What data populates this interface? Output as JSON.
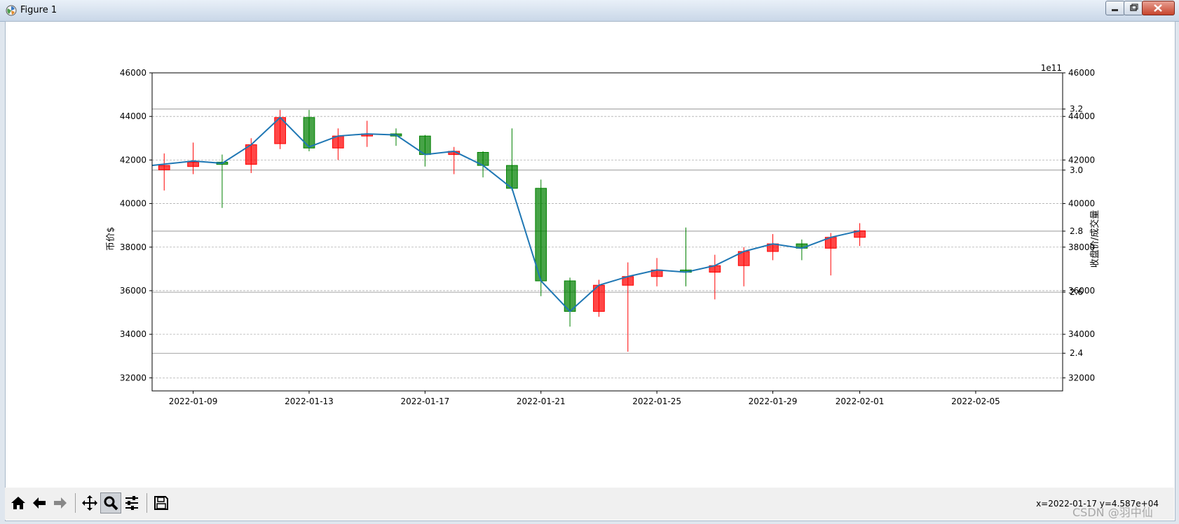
{
  "window": {
    "title": "Figure 1"
  },
  "toolbar": {
    "buttons": [
      {
        "name": "home-button",
        "icon": "home-icon"
      },
      {
        "name": "back-button",
        "icon": "back-arrow-icon"
      },
      {
        "name": "forward-button",
        "icon": "forward-arrow-icon"
      },
      {
        "name": "pan-button",
        "icon": "pan-icon"
      },
      {
        "name": "zoom-button",
        "icon": "zoom-icon"
      },
      {
        "name": "configure-subplots-button",
        "icon": "sliders-icon"
      },
      {
        "name": "save-button",
        "icon": "save-icon"
      }
    ],
    "coords": "x=2022-01-17 y=4.587e+04"
  },
  "watermark": "CSDN @羽中仙",
  "chart_data": {
    "type": "candlestick",
    "ylabel": "币价$",
    "ylabel_right": "收盘价/成交量",
    "offset_text_right": "1e11",
    "ylim": [
      31400,
      46000
    ],
    "xlim": [
      "2022-01-07T14:00",
      "2022-02-08"
    ],
    "x_ticks": [
      "2022-01-09",
      "2022-01-13",
      "2022-01-17",
      "2022-01-21",
      "2022-01-25",
      "2022-01-29",
      "2022-02-01",
      "2022-02-05"
    ],
    "y_ticks": [
      32000,
      34000,
      36000,
      38000,
      40000,
      42000,
      44000,
      46000
    ],
    "right_ticks": [
      32000,
      34000,
      36000,
      38000,
      40000,
      42000,
      44000,
      46000
    ],
    "volume_ticks": [
      "2.4",
      "2.6",
      "2.8",
      "3.0",
      "3.2"
    ],
    "volume_tick_values": [
      2.4,
      2.6,
      2.8,
      3.0,
      3.2
    ],
    "volume_ylim": [
      2.2766,
      3.3186
    ],
    "grid": true,
    "colors": {
      "up": "#ff0000",
      "down": "#008000",
      "line": "#1f77b4",
      "grid": "#b0b0b0"
    },
    "candles": [
      {
        "date": "2022-01-08",
        "open": 41550,
        "close": 41750,
        "high": 42300,
        "low": 40600
      },
      {
        "date": "2022-01-09",
        "open": 41700,
        "close": 41900,
        "high": 42800,
        "low": 41350
      },
      {
        "date": "2022-01-10",
        "open": 41900,
        "close": 41800,
        "high": 42250,
        "low": 39800
      },
      {
        "date": "2022-01-11",
        "open": 41800,
        "close": 42700,
        "high": 43000,
        "low": 41400
      },
      {
        "date": "2022-01-12",
        "open": 42750,
        "close": 43950,
        "high": 44300,
        "low": 42500
      },
      {
        "date": "2022-01-13",
        "open": 43950,
        "close": 42550,
        "high": 44300,
        "low": 42400
      },
      {
        "date": "2022-01-14",
        "open": 42550,
        "close": 43100,
        "high": 43450,
        "low": 42000
      },
      {
        "date": "2022-01-15",
        "open": 43100,
        "close": 43200,
        "high": 43800,
        "low": 42600
      },
      {
        "date": "2022-01-16",
        "open": 43200,
        "close": 43100,
        "high": 43450,
        "low": 42650
      },
      {
        "date": "2022-01-17",
        "open": 43100,
        "close": 42250,
        "high": 43150,
        "low": 41700
      },
      {
        "date": "2022-01-18",
        "open": 42250,
        "close": 42400,
        "high": 42600,
        "low": 41350
      },
      {
        "date": "2022-01-19",
        "open": 42350,
        "close": 41750,
        "high": 42400,
        "low": 41200
      },
      {
        "date": "2022-01-20",
        "open": 41750,
        "close": 40700,
        "high": 43450,
        "low": 40600
      },
      {
        "date": "2022-01-21",
        "open": 40700,
        "close": 36450,
        "high": 41100,
        "low": 35750
      },
      {
        "date": "2022-01-22",
        "open": 36450,
        "close": 35050,
        "high": 36600,
        "low": 34350
      },
      {
        "date": "2022-01-23",
        "open": 35050,
        "close": 36250,
        "high": 36500,
        "low": 34800
      },
      {
        "date": "2022-01-24",
        "open": 36250,
        "close": 36650,
        "high": 37300,
        "low": 33200
      },
      {
        "date": "2022-01-25",
        "open": 36650,
        "close": 36950,
        "high": 37500,
        "low": 36200
      },
      {
        "date": "2022-01-26",
        "open": 36950,
        "close": 36850,
        "high": 38900,
        "low": 36200
      },
      {
        "date": "2022-01-27",
        "open": 36850,
        "close": 37150,
        "high": 37650,
        "low": 35600
      },
      {
        "date": "2022-01-28",
        "open": 37150,
        "close": 37800,
        "high": 38000,
        "low": 36200
      },
      {
        "date": "2022-01-29",
        "open": 37800,
        "close": 38150,
        "high": 38600,
        "low": 37400
      },
      {
        "date": "2022-01-30",
        "open": 38150,
        "close": 37950,
        "high": 38350,
        "low": 37400
      },
      {
        "date": "2022-01-31",
        "open": 37950,
        "close": 38450,
        "high": 38650,
        "low": 36700
      },
      {
        "date": "2022-02-01",
        "open": 38450,
        "close": 38750,
        "high": 39100,
        "low": 38050
      }
    ],
    "close_line": {
      "dates": [
        "2022-01-07T14:00",
        "2022-01-09",
        "2022-01-10",
        "2022-01-11",
        "2022-01-12",
        "2022-01-13",
        "2022-01-14",
        "2022-01-15",
        "2022-01-16",
        "2022-01-17",
        "2022-01-18",
        "2022-01-19",
        "2022-01-20",
        "2022-01-21",
        "2022-01-22",
        "2022-01-23",
        "2022-01-24",
        "2022-01-25",
        "2022-01-26",
        "2022-01-27",
        "2022-01-28",
        "2022-01-29",
        "2022-01-30",
        "2022-01-31",
        "2022-02-01"
      ],
      "values": [
        41750,
        41950,
        41850,
        42700,
        43950,
        42600,
        43100,
        43200,
        43150,
        42250,
        42400,
        41750,
        40700,
        36450,
        35050,
        36250,
        36650,
        36950,
        36850,
        37150,
        37800,
        38150,
        37950,
        38450,
        38750
      ]
    }
  }
}
